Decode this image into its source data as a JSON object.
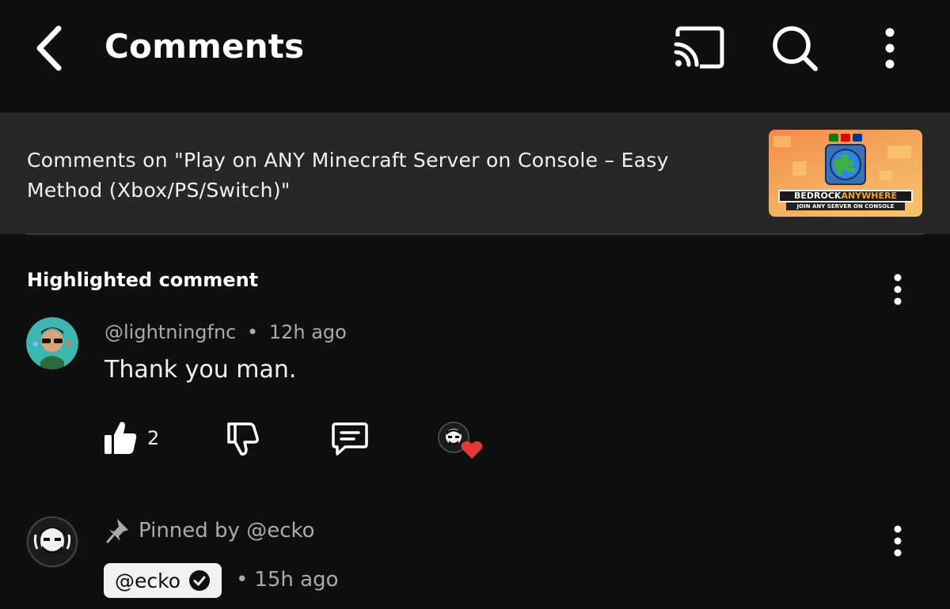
{
  "header": {
    "title": "Comments",
    "icons": [
      "back-arrow-icon",
      "cast-icon",
      "search-icon",
      "more-vertical-icon"
    ]
  },
  "video": {
    "comments_on": "Comments on \"Play on ANY Minecraft Server on Console – Easy Method (Xbox/PS/Switch)\"",
    "thumbnail": {
      "brand_part1": "BEDROCK",
      "brand_part2": "ANYWHERE",
      "tagline": "JOIN ANY SERVER ON CONSOLE"
    }
  },
  "highlighted": {
    "label": "Highlighted comment",
    "author": "@lightningfnc",
    "separator": "•",
    "time": "12h ago",
    "text": "Thank you man.",
    "likes": "2"
  },
  "pinned_comment": {
    "pinned_label": "Pinned by @ecko",
    "author": "@ecko",
    "separator": "•",
    "time": "15h ago"
  },
  "colors": {
    "background": "#0f0f0f",
    "banner": "#272727",
    "heart": "#e53935",
    "meta_text": "#aaaaaa"
  }
}
